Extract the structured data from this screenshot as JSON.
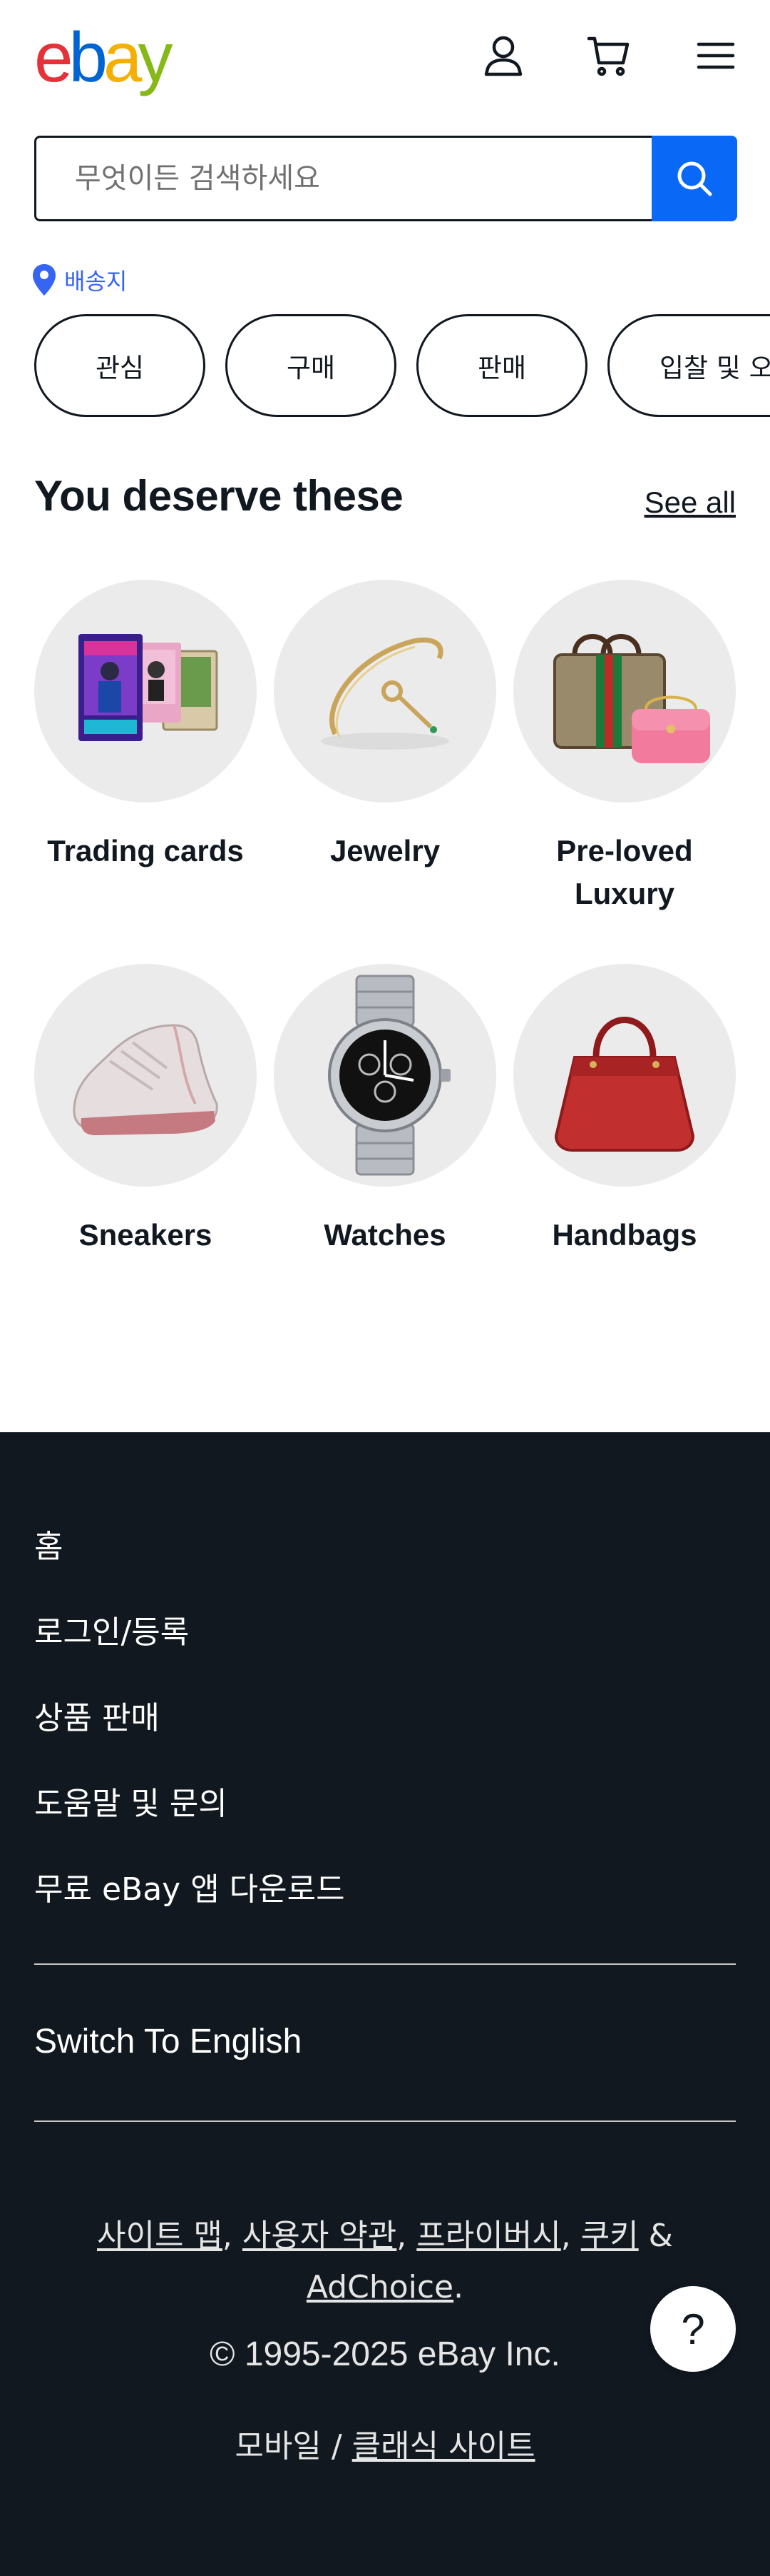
{
  "header": {
    "logo": [
      "e",
      "b",
      "a",
      "y"
    ],
    "logo_colors": [
      "#e53238",
      "#0064d2",
      "#f5af02",
      "#86b817"
    ],
    "icons": [
      "user-icon",
      "cart-icon",
      "menu-icon"
    ]
  },
  "search": {
    "placeholder": "무엇이든 검색하세요",
    "button_icon": "search-icon",
    "accent": "#0968f6"
  },
  "ship_to": {
    "label": "배송지",
    "icon": "location-pin-icon"
  },
  "chips": [
    "관심",
    "구매",
    "판매",
    "입찰 및 오퍼"
  ],
  "section": {
    "title": "You deserve these",
    "see_all": "See all",
    "tiles": [
      {
        "label": "Trading cards",
        "icon": "trading-cards-image"
      },
      {
        "label": "Jewelry",
        "icon": "bracelet-image"
      },
      {
        "label": "Pre-loved Luxury",
        "icon": "luxury-bags-image"
      },
      {
        "label": "Sneakers",
        "icon": "sneaker-image"
      },
      {
        "label": "Watches",
        "icon": "watch-image"
      },
      {
        "label": "Handbags",
        "icon": "handbag-image"
      }
    ]
  },
  "footer": {
    "links": [
      "홈",
      "로그인/등록",
      "상품 판매",
      "도움말 및 문의",
      "무료 eBay 앱 다운로드"
    ],
    "switch_language": "Switch To English",
    "legal": {
      "sitemap": "사이트 맵",
      "terms": "사용자 약관",
      "privacy": "프라이버시",
      "cookies": "쿠키",
      "amp": "&",
      "adchoice": "AdChoice",
      "comma": ",",
      "period": "."
    },
    "copyright": "© 1995-2025 eBay Inc.",
    "mobile": "모바일",
    "separator": "/",
    "classic_site": "클래식 사이트",
    "help_button": "?"
  }
}
